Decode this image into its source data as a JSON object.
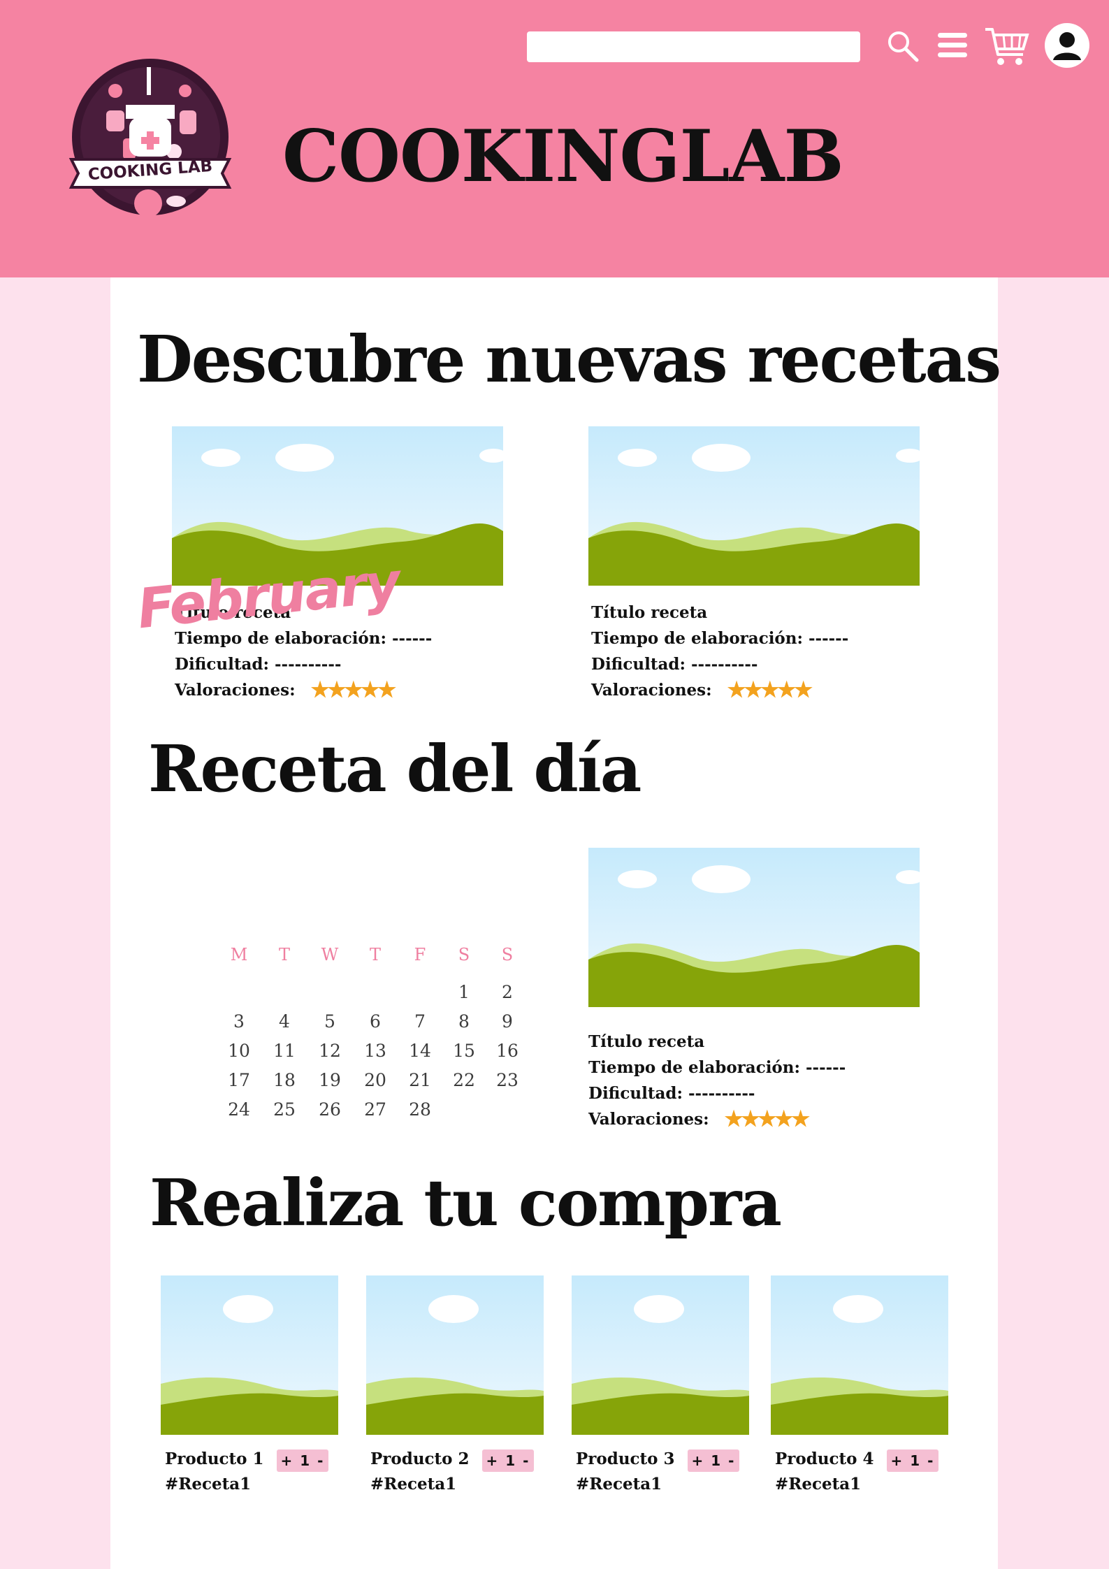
{
  "header": {
    "brand": "COOKINGLAB",
    "logo_text": "COOKING LAB",
    "search_value": "",
    "icons": [
      "search-icon",
      "menu-icon",
      "cart-icon",
      "user-icon"
    ]
  },
  "sections": {
    "discover_title": "Descubre nuevas recetas",
    "daily_title": "Receta del día",
    "shop_title": "Realiza tu compra"
  },
  "recipes": [
    {
      "title": "Título receta",
      "time": "Tiempo de elaboración: ------",
      "difficulty": "Dificultad: ----------",
      "ratings_label": "Valoraciones:",
      "stars": "★★★★★",
      "rating": 5
    },
    {
      "title": "Título receta",
      "time": "Tiempo de elaboración: ------",
      "difficulty": "Dificultad: ----------",
      "ratings_label": "Valoraciones:",
      "stars": "★★★★★",
      "rating": 5
    }
  ],
  "daily_recipe": {
    "title": "Título receta",
    "time": "Tiempo de elaboración: ------",
    "difficulty": "Dificultad: ----------",
    "ratings_label": "Valoraciones:",
    "stars": "★★★★★",
    "rating": 5
  },
  "calendar": {
    "month": "February",
    "weekdays": [
      "M",
      "T",
      "W",
      "T",
      "F",
      "S",
      "S"
    ],
    "weeks": [
      [
        "",
        "",
        "",
        "",
        "",
        "1",
        "2"
      ],
      [
        "3",
        "4",
        "5",
        "6",
        "7",
        "8",
        "9"
      ],
      [
        "10",
        "11",
        "12",
        "13",
        "14",
        "15",
        "16"
      ],
      [
        "17",
        "18",
        "19",
        "20",
        "21",
        "22",
        "23"
      ],
      [
        "24",
        "25",
        "26",
        "27",
        "28",
        "",
        ""
      ]
    ]
  },
  "products": [
    {
      "name": "Producto 1",
      "tag": "#Receta1",
      "qty": "+ 1 -"
    },
    {
      "name": "Producto 2",
      "tag": "#Receta1",
      "qty": "+ 1 -"
    },
    {
      "name": "Producto 3",
      "tag": "#Receta1",
      "qty": "+ 1 -"
    },
    {
      "name": "Producto 4",
      "tag": "#Receta1",
      "qty": "+ 1 -"
    }
  ],
  "colors": {
    "header": "#f583a2",
    "page_bg": "#fde1ed",
    "accent_pink": "#ef7fa0",
    "star": "#f3a21e",
    "qty_bg": "#f5bfd3"
  }
}
